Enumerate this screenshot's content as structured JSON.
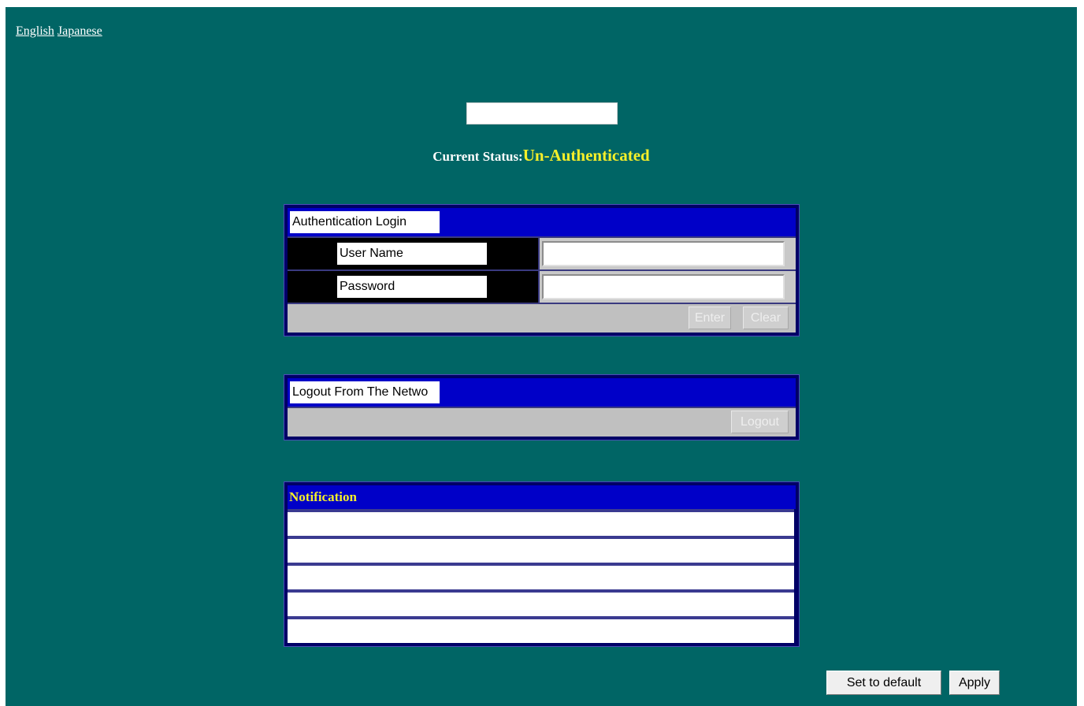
{
  "language_links": [
    "English",
    "Japanese"
  ],
  "status": {
    "label": "Current Status:",
    "value": "Un-Authenticated"
  },
  "login_panel": {
    "title": "Authentication Login",
    "username_label": "User Name",
    "username_value": "",
    "password_label": "Password",
    "password_value": "",
    "enter_label": "Enter",
    "clear_label": "Clear"
  },
  "logout_panel": {
    "title": "Logout From The Netwo",
    "logout_label": "Logout"
  },
  "notification": {
    "title": "Notification",
    "rows": [
      "",
      "",
      "",
      "",
      ""
    ]
  },
  "footer": {
    "default_label": "Set to default",
    "apply_label": "Apply"
  },
  "colors": {
    "background": "#006565",
    "panel_header": "#0000c8",
    "status_value": "#f5ef2a"
  }
}
